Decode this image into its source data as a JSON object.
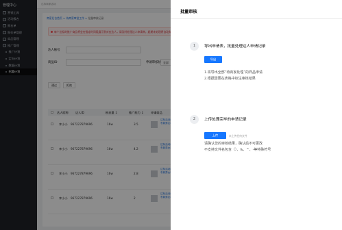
{
  "sidebar": {
    "logo": "管理中心",
    "items": [
      {
        "label": "营销工具",
        "type": "top"
      },
      {
        "label": "活动报名",
        "type": "top"
      },
      {
        "label": "报名单",
        "type": "top"
      },
      {
        "label": "报价单管理",
        "type": "top"
      },
      {
        "label": "商品管理",
        "type": "top"
      },
      {
        "label": "推广管理",
        "type": "top"
      },
      {
        "label": "推广计划",
        "type": "sub"
      },
      {
        "label": "定向计划",
        "type": "sub"
      },
      {
        "label": "数据计划",
        "type": "sub"
      },
      {
        "label": "招募计划",
        "type": "sub",
        "active": true
      }
    ]
  },
  "topbar": {
    "breadcrumb": "达标商家活动"
  },
  "main": {
    "crumb_links": "商家后台首页 > 待商家审批工作 >",
    "crumb_current": " 批量审核记录",
    "alert": "每个达标的推广商品将会在指定时间段展示到对应达人，请及时处理达人申请单，超期未处理将自动失效",
    "filters": {
      "talent_account_label": "达人账号",
      "talent_id_label": "达人ID",
      "product_id_label": "商品ID",
      "status_label": "申请审核状态",
      "status_value": "全部"
    },
    "actions": {
      "pass": "通过",
      "reject": "拒绝"
    },
    "table": {
      "headers": [
        "达人昵称",
        "达人ID",
        "粉丝量 ↕",
        "推广能力 ↕",
        "申请商品"
      ],
      "rows": [
        {
          "name": "李小小",
          "id": "967227879696",
          "fans": "16w",
          "score": "3.5",
          "link": "达标活动商品推广 新款秋冬款男女装 时尚百搭款"
        },
        {
          "name": "李小小",
          "id": "967227879696",
          "fans": "16w",
          "score": "4.2",
          "link": "达标活动商品推广 新款秋冬款男女装 时尚百搭款"
        },
        {
          "name": "李小小",
          "id": "967227879696",
          "fans": "16w",
          "score": "2.8",
          "link": "达标活动商品推广 新款秋冬款男女装 时尚百搭款"
        },
        {
          "name": "李小小",
          "id": "967227879696",
          "fans": "16w",
          "score": "2",
          "link": "达标活动商品推广 新款秋冬款男女装 时尚百搭款"
        }
      ]
    }
  },
  "modal": {
    "title": "批量审核",
    "step1": {
      "num": "1",
      "title": "导出申请表，批量处理达人申请记录",
      "button": "导出",
      "notes": [
        "1.将导出全部“待商家处理”的样品申请",
        "2.根据需要在表格中标注审核结果"
      ]
    },
    "step2": {
      "num": "2",
      "title": "上传处理完毕的申请记录",
      "button": "上传",
      "hint": "未上传任何文件",
      "notes": [
        "请确认您的审核结果，确认后不可更改",
        "不支持文件名包含（）、&、^、-等特殊符号"
      ]
    }
  },
  "colors": {
    "primary": "#1677ff",
    "sidebar_bg": "#1f2227",
    "alert_text": "#d9363e"
  }
}
